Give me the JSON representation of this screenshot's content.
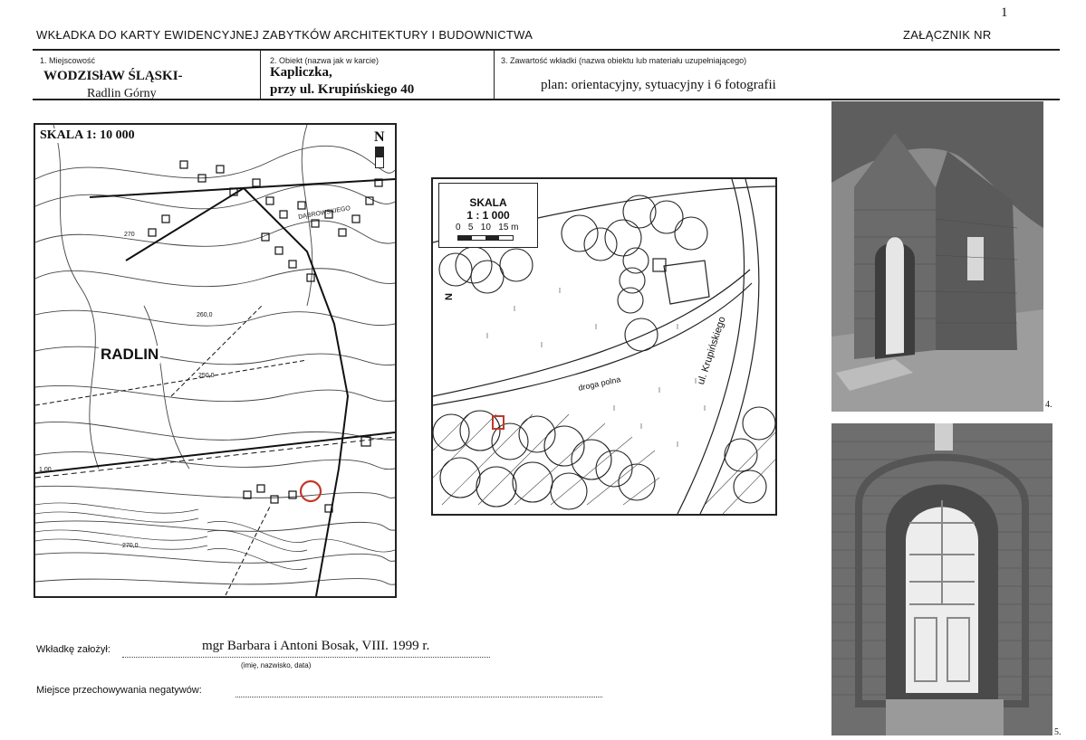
{
  "header": {
    "title": "WKŁADKA DO KARTY EWIDENCYJNEJ ZABYTKÓW  ARCHITEKTURY I BUDOWNICTWA",
    "annex": "ZAŁĄCZNIK NR",
    "page_number": "1"
  },
  "fields": {
    "place_label": "1. Miejscowość",
    "place_value_main": "WODZISłAW ŚLĄSKI-",
    "place_value_sub": "Radlin Górny",
    "object_label": "2. Obiekt (nazwa jak w karcie)",
    "object_value_1": "Kapliczka,",
    "object_value_2": "przy  ul. Krupińskiego 40",
    "content_label": "3. Zawartość wkładki (nazwa obiektu lub materiału uzupełniającego)",
    "content_value": "plan:  orientacyjny,  sytuacyjny  i  6  fotografii"
  },
  "map_left": {
    "scale": "SKALA 1: 10 000",
    "north": "N",
    "town": "RADLIN",
    "street": "DĄBROWSKIEGO",
    "contour_labels": [
      "270",
      "260,0",
      "250,0",
      "1,00",
      "270,0"
    ]
  },
  "map_center": {
    "scale_title": "SKALA",
    "scale_ratio": "1 : 1 000",
    "scale_ticks": "0   5   10   15 m",
    "road_label": "droga polna",
    "street_label": "ul. Krupińskiego",
    "north": "N"
  },
  "footer": {
    "author_label": "Wkładkę założył:",
    "author_value": "mgr Barbara i Antoni Bosak, VIII. 1999 r.",
    "author_hint": "(imię, nazwisko, data)",
    "storage_label": "Miejsce przechowywania negatywów:"
  },
  "photos": {
    "photo_top_number": "4.",
    "photo_bottom_number": "5."
  },
  "colors": {
    "marker": "#c0392b",
    "ink": "#222222"
  }
}
